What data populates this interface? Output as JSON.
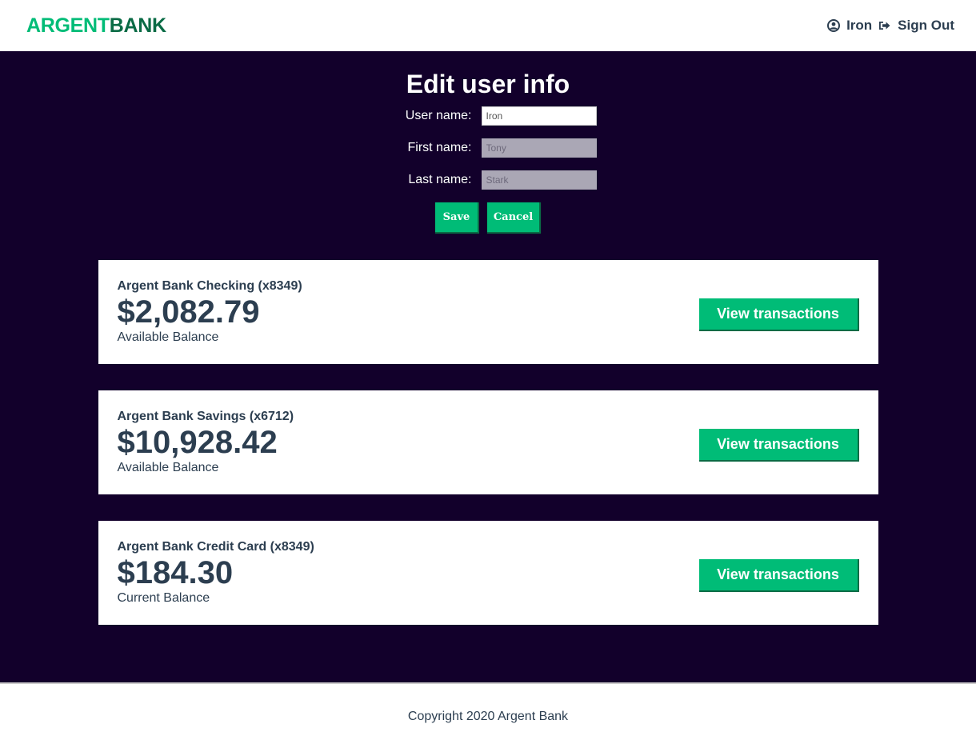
{
  "navbar": {
    "logo_part1": "ARGENT",
    "logo_part2": "BANK",
    "user_icon": "user-circle-icon",
    "user_name": "Iron",
    "signout_icon": "sign-out-icon",
    "signout_label": "Sign Out"
  },
  "header": {
    "title": "Edit user info",
    "fields": {
      "username_label": "User name:",
      "username_value": "Iron",
      "firstname_label": "First name:",
      "firstname_value": "Tony",
      "lastname_label": "Last name:",
      "lastname_value": "Stark"
    },
    "save_label": "Save",
    "cancel_label": "Cancel"
  },
  "accounts": [
    {
      "title": "Argent Bank Checking (x8349)",
      "amount": "$2,082.79",
      "description": "Available Balance",
      "button": "View transactions"
    },
    {
      "title": "Argent Bank Savings (x6712)",
      "amount": "$10,928.42",
      "description": "Available Balance",
      "button": "View transactions"
    },
    {
      "title": "Argent Bank Credit Card (x8349)",
      "amount": "$184.30",
      "description": "Current Balance",
      "button": "View transactions"
    }
  ],
  "footer": {
    "text": "Copyright 2020 Argent Bank"
  },
  "colors": {
    "accent": "#00bc77",
    "accent_dark": "#0a6b45",
    "background_dark": "#12002b",
    "text": "#2c3e50"
  }
}
